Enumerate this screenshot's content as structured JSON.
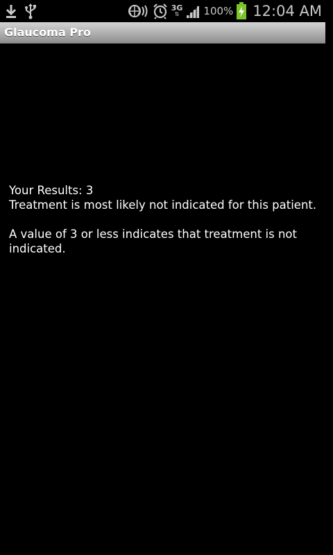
{
  "status_bar": {
    "left_icons": [
      "download-icon",
      "usb-icon"
    ],
    "right_icons": [
      "nfc-icon",
      "alarm-icon",
      "network-3g-icon",
      "signal-icon",
      "battery-charging-icon"
    ],
    "network_type": "3G",
    "battery_percent": "100%",
    "time": "12:04 AM"
  },
  "app": {
    "title": "Glaucoma Pro"
  },
  "results": {
    "score_line": "Your Results: 3",
    "recommendation": "Treatment is most likely not indicated for this patient.",
    "explanation": "A value of 3 or less indicates that treatment is not indicated."
  },
  "colors": {
    "background": "#000000",
    "text": "#ffffff",
    "title_bar": "#b0b0b0",
    "battery_charge": "#7cc42a"
  }
}
